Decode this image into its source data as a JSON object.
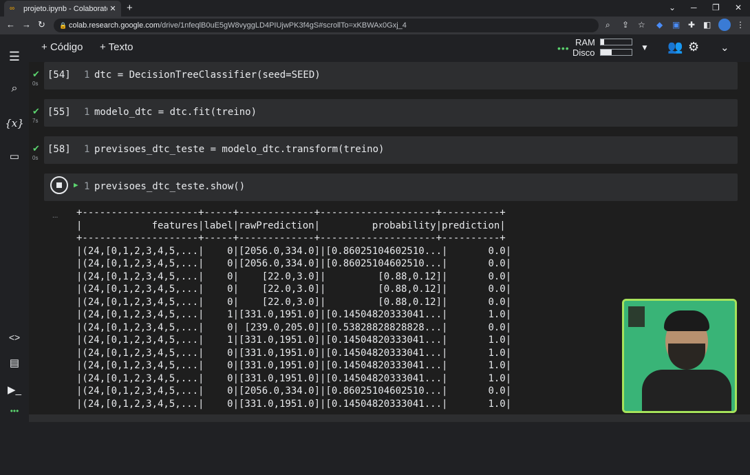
{
  "browser": {
    "tab_title": "projeto.ipynb - Colaboratory",
    "tab_icon": "colab-logo-icon",
    "url_host": "colab.research.google.com",
    "url_path": "/drive/1nfeqlB0uE5gW8vyggLD4PIUjwPK3f4gS#scrollTo=xKBWAx0Gxj_4",
    "window_controls": [
      "⌄",
      "─",
      "❐",
      "✕"
    ]
  },
  "toolbar": {
    "add_code_label": "Código",
    "add_text_label": "Texto",
    "ram_label": "RAM",
    "disk_label": "Disco",
    "ram_usage": 0.12,
    "disk_usage": 0.35
  },
  "cells": [
    {
      "number": "[54]",
      "line": "1",
      "code": "dtc = DecisionTreeClassifier(seed=SEED)",
      "time": "0s",
      "status": "done"
    },
    {
      "number": "[55]",
      "line": "1",
      "code": "modelo_dtc = dtc.fit(treino)",
      "time": "7s",
      "status": "done"
    },
    {
      "number": "[58]",
      "line": "1",
      "code": "previsoes_dtc_teste = modelo_dtc.transform(treino)",
      "time": "0s",
      "status": "done"
    },
    {
      "number": "",
      "line": "1",
      "code": "previsoes_dtc_teste.show()",
      "time": "",
      "status": "running"
    }
  ],
  "output": {
    "ellipsis": "...",
    "lines": [
      "+--------------------+-----+-------------+--------------------+----------+",
      "|            features|label|rawPrediction|         probability|prediction|",
      "+--------------------+-----+-------------+--------------------+----------+",
      "|(24,[0,1,2,3,4,5,...|    0|[2056.0,334.0]|[0.86025104602510...|       0.0|",
      "|(24,[0,1,2,3,4,5,...|    0|[2056.0,334.0]|[0.86025104602510...|       0.0|",
      "|(24,[0,1,2,3,4,5,...|    0|    [22.0,3.0]|         [0.88,0.12]|       0.0|",
      "|(24,[0,1,2,3,4,5,...|    0|    [22.0,3.0]|         [0.88,0.12]|       0.0|",
      "|(24,[0,1,2,3,4,5,...|    0|    [22.0,3.0]|         [0.88,0.12]|       0.0|",
      "|(24,[0,1,2,3,4,5,...|    1|[331.0,1951.0]|[0.14504820333041...|       1.0|",
      "|(24,[0,1,2,3,4,5,...|    0| [239.0,205.0]|[0.53828828828828...|       0.0|",
      "|(24,[0,1,2,3,4,5,...|    1|[331.0,1951.0]|[0.14504820333041...|       1.0|",
      "|(24,[0,1,2,3,4,5,...|    0|[331.0,1951.0]|[0.14504820333041...|       1.0|",
      "|(24,[0,1,2,3,4,5,...|    0|[331.0,1951.0]|[0.14504820333041...|       1.0|",
      "|(24,[0,1,2,3,4,5,...|    0|[331.0,1951.0]|[0.14504820333041...|       1.0|",
      "|(24,[0,1,2,3,4,5,...|    0|[2056.0,334.0]|[0.86025104602510...|       0.0|",
      "|(24,[0,1,2,3,4,5,...|    0|[331.0,1951.0]|[0.14504820333041...|       1.0|"
    ]
  },
  "colors": {
    "accent_green": "#5bd36e",
    "video_border": "#a6e35b"
  }
}
